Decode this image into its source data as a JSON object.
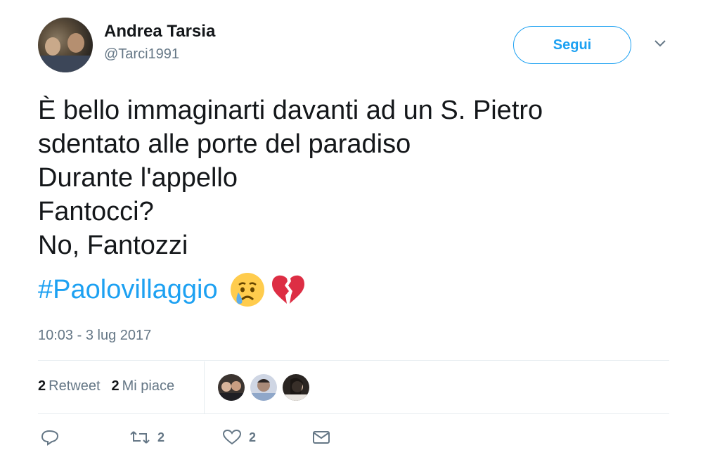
{
  "user": {
    "name": "Andrea Tarsia",
    "handle": "@Tarci1991"
  },
  "follow_label": "Segui",
  "tweet": {
    "lines": [
      "È bello immaginarti davanti ad un S. Pietro",
      "sdentato alle porte del paradiso",
      "Durante l'appello",
      "Fantocci?",
      "No, Fantozzi"
    ],
    "hashtag": "#Paolovillaggio",
    "emojis": [
      "crying-face",
      "broken-heart"
    ],
    "timestamp": "10:03 - 3 lug 2017"
  },
  "stats": {
    "retweets_count": "2",
    "retweets_label": "Retweet",
    "likes_count": "2",
    "likes_label": "Mi piace"
  },
  "actions": {
    "retweet_count": "2",
    "like_count": "2"
  },
  "colors": {
    "accent": "#1da1f2",
    "muted": "#657786",
    "text": "#14171a",
    "heart": "#e0245e"
  }
}
